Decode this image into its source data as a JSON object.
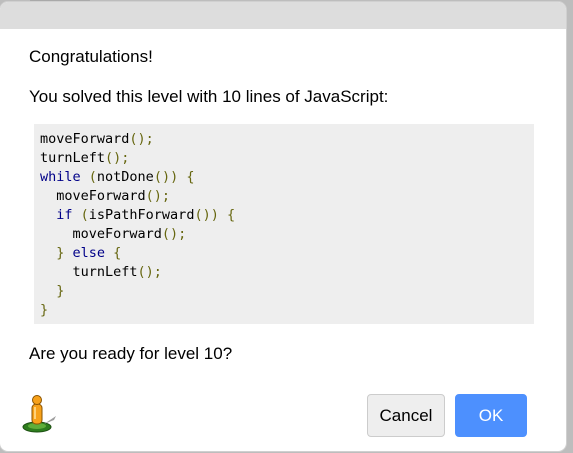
{
  "dialog": {
    "congrats": "Congratulations!",
    "solved_message": "You solved this level with 10 lines of JavaScript:",
    "code_lines": [
      [
        {
          "t": "moveForward",
          "c": "#000000"
        },
        {
          "t": "();",
          "c": "#66660f"
        }
      ],
      [
        {
          "t": "turnLeft",
          "c": "#000000"
        },
        {
          "t": "();",
          "c": "#66660f"
        }
      ],
      [
        {
          "t": "while",
          "c": "#000088"
        },
        {
          "t": " (",
          "c": "#66660f"
        },
        {
          "t": "notDone",
          "c": "#000000"
        },
        {
          "t": "()) {",
          "c": "#66660f"
        }
      ],
      [
        {
          "t": "  moveForward",
          "c": "#000000"
        },
        {
          "t": "();",
          "c": "#66660f"
        }
      ],
      [
        {
          "t": "  if",
          "c": "#000088"
        },
        {
          "t": " (",
          "c": "#66660f"
        },
        {
          "t": "isPathForward",
          "c": "#000000"
        },
        {
          "t": "()) {",
          "c": "#66660f"
        }
      ],
      [
        {
          "t": "    moveForward",
          "c": "#000000"
        },
        {
          "t": "();",
          "c": "#66660f"
        }
      ],
      [
        {
          "t": "  } ",
          "c": "#66660f"
        },
        {
          "t": "else",
          "c": "#000088"
        },
        {
          "t": " {",
          "c": "#66660f"
        }
      ],
      [
        {
          "t": "    turnLeft",
          "c": "#000000"
        },
        {
          "t": "();",
          "c": "#66660f"
        }
      ],
      [
        {
          "t": "  }",
          "c": "#66660f"
        }
      ],
      [
        {
          "t": "}",
          "c": "#66660f"
        }
      ]
    ],
    "ready_question": "Are you ready for level 10?",
    "cancel_label": "Cancel",
    "ok_label": "OK",
    "mascot_icon": "pegman-icon"
  },
  "colors": {
    "ok_button": "#4d90fe",
    "titlebar": "#dddddd",
    "code_background": "#eeeeee",
    "keyword": "#000088",
    "punctuation": "#66660f"
  }
}
